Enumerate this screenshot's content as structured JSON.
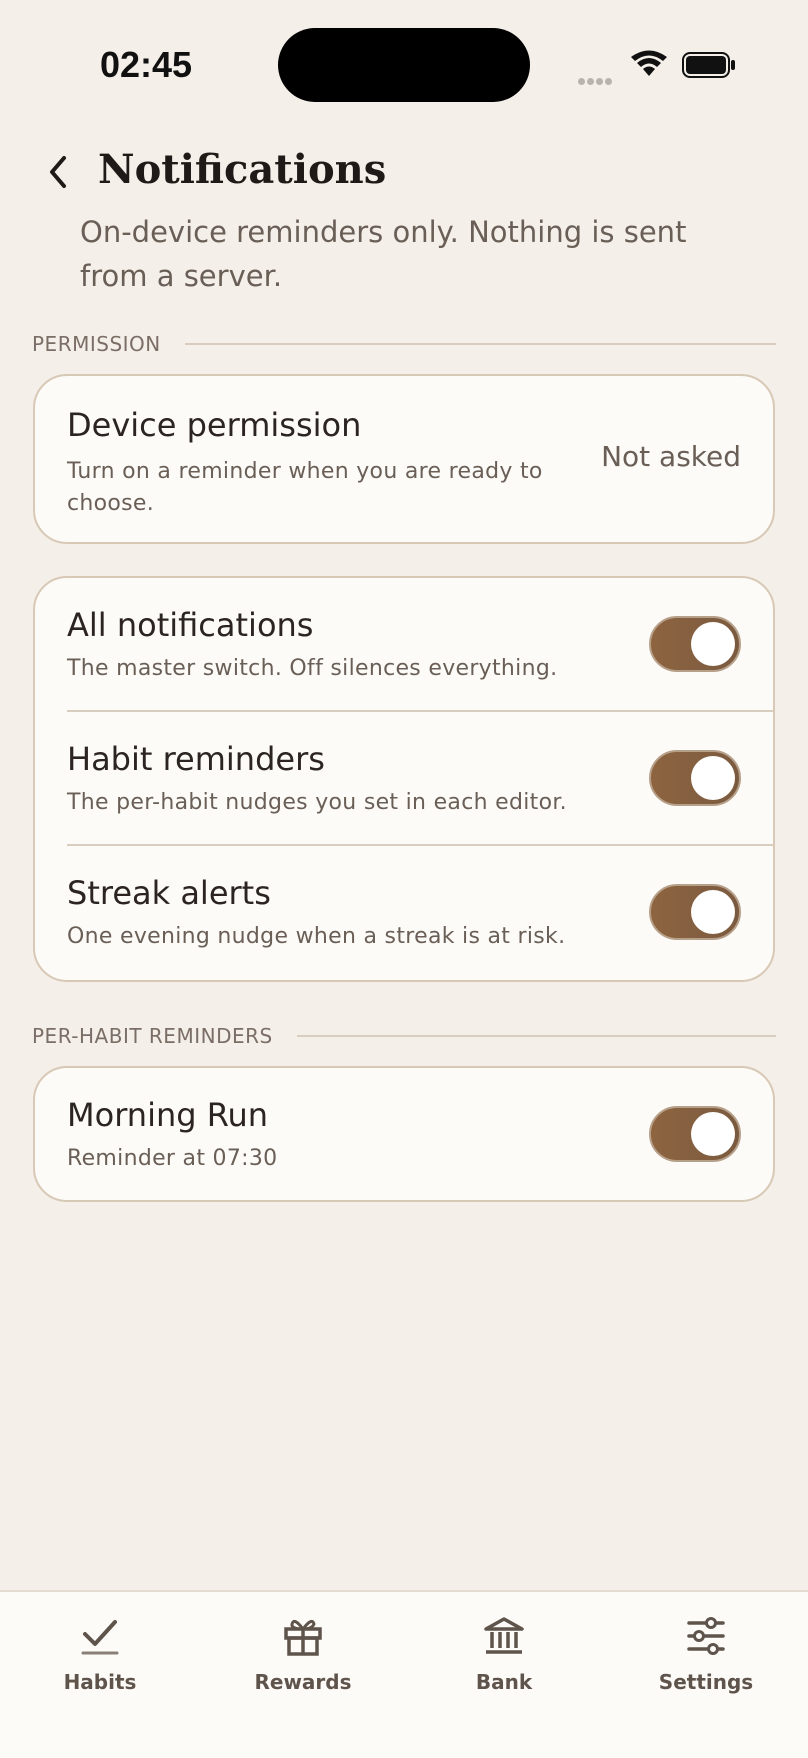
{
  "status_bar": {
    "time": "02:45"
  },
  "header": {
    "title": "Notifications",
    "subtitle": "On-device reminders only. Nothing is sent from a server."
  },
  "sections": {
    "permission_label": "PERMISSION",
    "per_habit_label": "PER-HABIT REMINDERS"
  },
  "permission": {
    "title": "Device permission",
    "description": "Turn on a reminder when you are ready to choose.",
    "status": "Not asked"
  },
  "settings": [
    {
      "title": "All notifications",
      "description": "The master switch. Off silences everything.",
      "enabled": true
    },
    {
      "title": "Habit reminders",
      "description": "The per-habit nudges you set in each editor.",
      "enabled": true
    },
    {
      "title": "Streak alerts",
      "description": "One evening nudge when a streak is at risk.",
      "enabled": true
    }
  ],
  "habit_reminders": [
    {
      "title": "Morning Run",
      "description": "Reminder at 07:30",
      "enabled": true
    }
  ],
  "tab_bar": [
    {
      "label": "Habits",
      "icon": "check-icon"
    },
    {
      "label": "Rewards",
      "icon": "gift-icon"
    },
    {
      "label": "Bank",
      "icon": "bank-icon"
    },
    {
      "label": "Settings",
      "icon": "sliders-icon"
    }
  ],
  "colors": {
    "background": "#f4efe8",
    "card": "#fdfbf7",
    "accent": "#8e6440"
  }
}
